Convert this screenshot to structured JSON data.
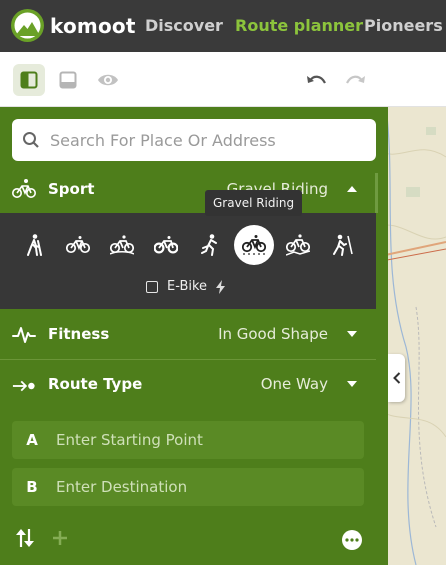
{
  "nav": {
    "brand": "komoot",
    "links": [
      "Discover",
      "Route planner",
      "Pioneers"
    ],
    "active": "Route planner"
  },
  "toolbar": {
    "icons": [
      "sidebar-icon",
      "tablet-icon",
      "eye-icon",
      "undo-icon",
      "redo-icon"
    ]
  },
  "search": {
    "placeholder": "Search For Place Or Address"
  },
  "sport": {
    "label": "Sport",
    "value": "Gravel Riding",
    "tooltip": "Gravel Riding",
    "options": [
      "hiking-icon",
      "bike-touring-icon",
      "road-cycling-icon",
      "mountain-biking-icon",
      "running-icon",
      "gravel-riding-icon",
      "mtb-enduro-icon",
      "mountaineering-icon"
    ],
    "selected_index": 5,
    "ebike_label": "E-Bike"
  },
  "fitness": {
    "label": "Fitness",
    "value": "In Good Shape"
  },
  "route_type": {
    "label": "Route Type",
    "value": "One Way"
  },
  "waypoints": [
    {
      "letter": "A",
      "placeholder": "Enter Starting Point"
    },
    {
      "letter": "B",
      "placeholder": "Enter Destination"
    }
  ],
  "colors": {
    "brand_green": "#6aa127",
    "panel_green": "#4e7e1b",
    "nav_dark": "#3a3a3a",
    "accent": "#8cc43c"
  }
}
